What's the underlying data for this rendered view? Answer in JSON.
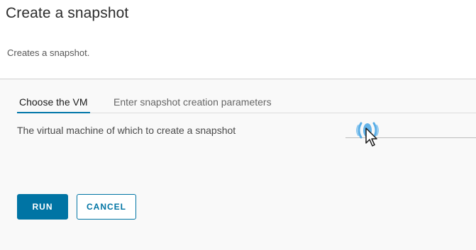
{
  "dialog": {
    "title": "Create a snapshot",
    "subtitle": "Creates a snapshot."
  },
  "tabs": [
    {
      "label": "Choose the VM",
      "active": true
    },
    {
      "label": "Enter snapshot creation parameters",
      "active": false
    }
  ],
  "vm_field": {
    "label": "The virtual machine of which to create a snapshot",
    "value": "",
    "loading_icon": "loading-spinner-icon"
  },
  "buttons": {
    "run_label": "RUN",
    "cancel_label": "CANCEL"
  },
  "colors": {
    "accent": "#0074a4",
    "spinner": "#5aaee6",
    "divider": "#cfcfcf"
  }
}
